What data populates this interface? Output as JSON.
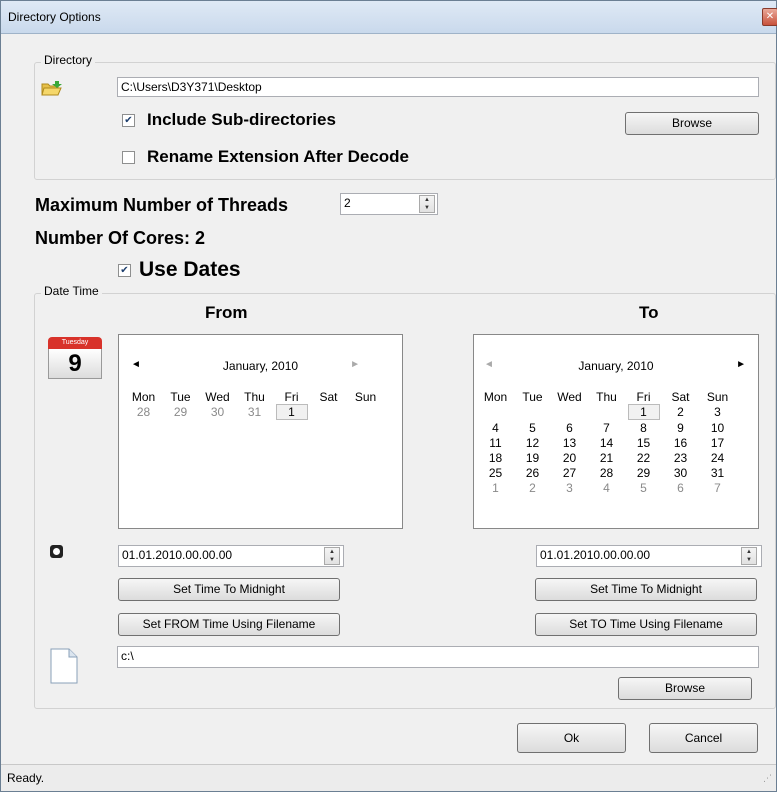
{
  "window": {
    "title": "Directory Options",
    "close_symbol": "✕"
  },
  "directory": {
    "legend": "Directory",
    "path": "C:\\Users\\D3Y371\\Desktop",
    "include_sub_label": "Include Sub-directories",
    "include_sub_checked": true,
    "rename_ext_label": "Rename Extension After Decode",
    "rename_ext_checked": false,
    "browse_label": "Browse"
  },
  "threads": {
    "label": "Maximum Number of Threads",
    "value": "2"
  },
  "cores": {
    "label": "Number Of Cores: 2"
  },
  "use_dates": {
    "label": "Use Dates",
    "checked": true
  },
  "datetime": {
    "legend": "Date Time",
    "calendar_icon": {
      "day_name": "Tuesday",
      "day_num": "9"
    },
    "from": {
      "heading": "From",
      "month_title": "January, 2010",
      "weekdays": [
        "Mon",
        "Tue",
        "Wed",
        "Thu",
        "Fri",
        "Sat",
        "Sun"
      ],
      "weeks": [
        [
          {
            "d": "28",
            "g": true
          },
          {
            "d": "29",
            "g": true
          },
          {
            "d": "30",
            "g": true
          },
          {
            "d": "31",
            "g": true
          },
          {
            "d": "1",
            "s": true
          },
          {
            "d": ""
          },
          {
            "d": ""
          }
        ]
      ],
      "datetime_value": "01.01.2010.00.00.00",
      "midnight_label": "Set Time To Midnight",
      "filename_label": "Set FROM Time Using Filename"
    },
    "to": {
      "heading": "To",
      "month_title": "January, 2010",
      "weekdays": [
        "Mon",
        "Tue",
        "Wed",
        "Thu",
        "Fri",
        "Sat",
        "Sun"
      ],
      "weeks": [
        [
          {
            "d": ""
          },
          {
            "d": ""
          },
          {
            "d": ""
          },
          {
            "d": ""
          },
          {
            "d": "1",
            "s": true
          },
          {
            "d": "2"
          },
          {
            "d": "3"
          }
        ],
        [
          {
            "d": "4"
          },
          {
            "d": "5"
          },
          {
            "d": "6"
          },
          {
            "d": "7"
          },
          {
            "d": "8"
          },
          {
            "d": "9"
          },
          {
            "d": "10"
          }
        ],
        [
          {
            "d": "11"
          },
          {
            "d": "12"
          },
          {
            "d": "13"
          },
          {
            "d": "14"
          },
          {
            "d": "15"
          },
          {
            "d": "16"
          },
          {
            "d": "17"
          }
        ],
        [
          {
            "d": "18"
          },
          {
            "d": "19"
          },
          {
            "d": "20"
          },
          {
            "d": "21"
          },
          {
            "d": "22"
          },
          {
            "d": "23"
          },
          {
            "d": "24"
          }
        ],
        [
          {
            "d": "25"
          },
          {
            "d": "26"
          },
          {
            "d": "27"
          },
          {
            "d": "28"
          },
          {
            "d": "29"
          },
          {
            "d": "30"
          },
          {
            "d": "31"
          }
        ],
        [
          {
            "d": "1",
            "g": true
          },
          {
            "d": "2",
            "g": true
          },
          {
            "d": "3",
            "g": true
          },
          {
            "d": "4",
            "g": true
          },
          {
            "d": "5",
            "g": true
          },
          {
            "d": "6",
            "g": true
          },
          {
            "d": "7",
            "g": true
          }
        ]
      ],
      "datetime_value": "01.01.2010.00.00.00",
      "midnight_label": "Set Time To Midnight",
      "filename_label": "Set TO Time Using Filename"
    },
    "file_path": "c:\\",
    "browse_label": "Browse"
  },
  "buttons": {
    "ok": "Ok",
    "cancel": "Cancel"
  },
  "status": {
    "text": "Ready."
  }
}
